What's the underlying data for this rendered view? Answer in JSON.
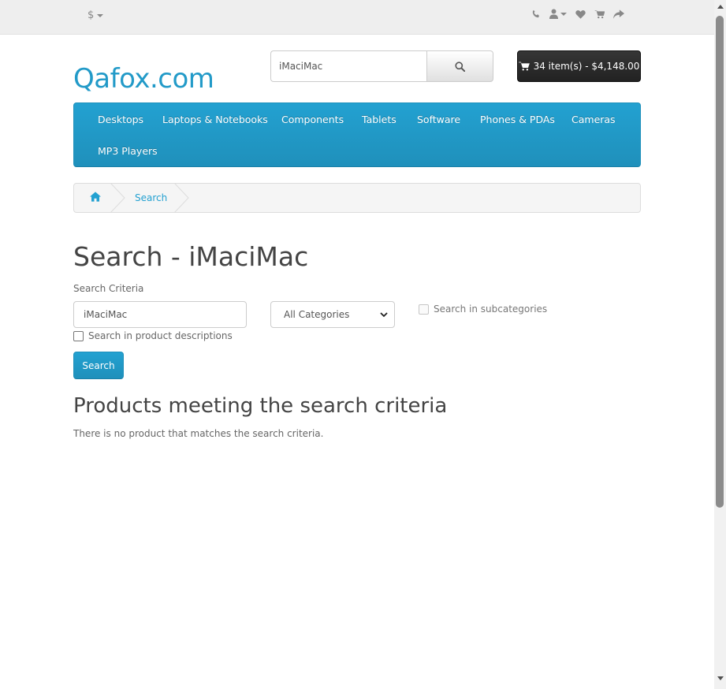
{
  "topbar": {
    "currency_symbol": "$",
    "icons": [
      "phone-icon",
      "user-icon",
      "heart-icon",
      "cart-icon",
      "share-icon"
    ]
  },
  "header": {
    "logo": "Qafox.com",
    "search_value": "iMaciMac",
    "cart_label": "34 item(s) - $4,148.00"
  },
  "menu": {
    "items": [
      "Desktops",
      "Laptops & Notebooks",
      "Components",
      "Tablets",
      "Software",
      "Phones & PDAs",
      "Cameras",
      "MP3 Players"
    ]
  },
  "breadcrumb": {
    "items": [
      "home-icon",
      "Search"
    ],
    "search_label": "Search"
  },
  "content": {
    "title": "Search - iMaciMac",
    "criteria_label": "Search Criteria",
    "keyword_value": "iMaciMac",
    "category_selected": "All Categories",
    "subcategories_label": "Search in subcategories",
    "descriptions_label": "Search in product descriptions",
    "search_button": "Search",
    "results_heading": "Products meeting the search criteria",
    "no_results": "There is no product that matches the search criteria."
  },
  "colors": {
    "accent": "#229ac8",
    "menu_bg": "#23a1d1",
    "cart_bg": "#222222",
    "topbar_bg": "#eeeeee"
  }
}
